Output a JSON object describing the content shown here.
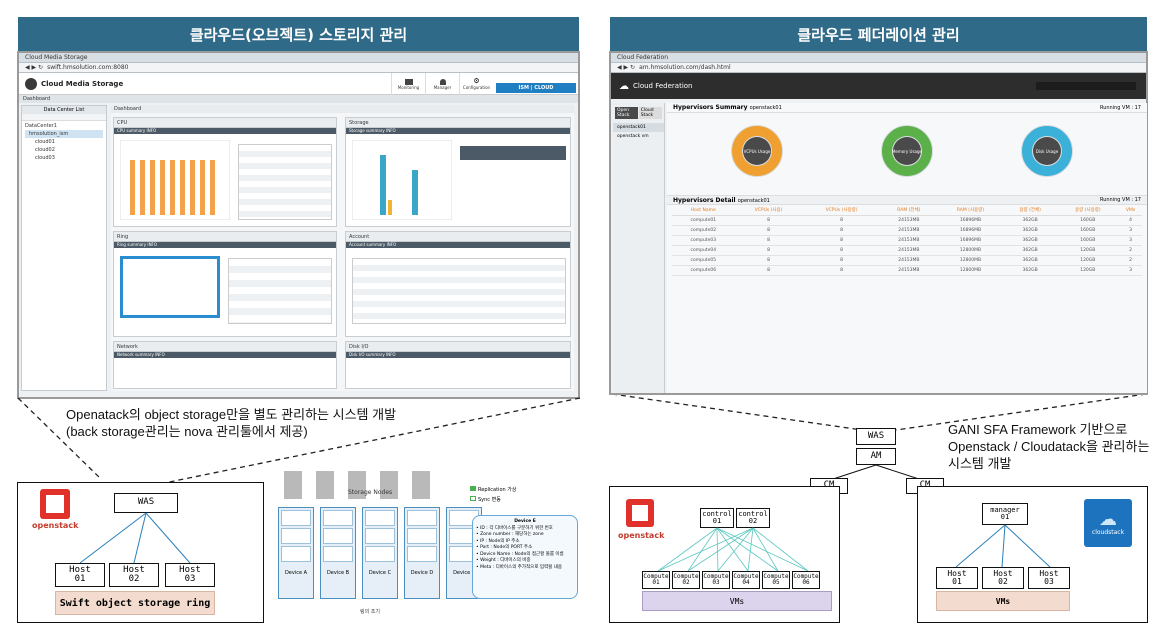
{
  "left": {
    "header": "클라우드(오브젝트) 스토리지 관리",
    "browser": {
      "tab": "Cloud Media Storage",
      "url": "swift.hmsolution.com:8080",
      "app_title": "Cloud Media Storage",
      "nav": [
        "Monitoring",
        "Manager",
        "Configuration"
      ],
      "badge": "ISM | CLOUD",
      "dashboard_label": "Dashboard",
      "tree_header": "Data Center List",
      "tree_items": [
        "DataCenter1",
        "hmsolution_ism",
        "cloud01",
        "cloud02",
        "cloud03"
      ],
      "cards": [
        "CPU",
        "Storage",
        "Ring",
        "Account",
        "Network",
        "Disk I/O"
      ],
      "card_subs": [
        "CPU summary INFO",
        "Storage summary INFO",
        "Ring summary INFO",
        "Account summary INFO",
        "Network summary INFO",
        "Disk I/O summary INFO"
      ]
    },
    "caption_line1": "Openatack의 object storage만을 별도 관리하는 시스템 개발",
    "caption_line2": "(back storage관리는 nova 관리툴에서 제공)",
    "diagram": {
      "logo_text": "openstack",
      "was": "WAS",
      "hosts": [
        "Host\n01",
        "Host\n02",
        "Host\n03"
      ],
      "ring": "Swift object storage ring"
    },
    "storage_fig": {
      "title": "Storage Nodes",
      "devices": [
        "Device A",
        "Device B",
        "Device C",
        "Device D",
        "Device E"
      ],
      "legend": [
        "Replication 가상",
        "Sync 변동"
      ],
      "note_title": "Device E",
      "note_lines": [
        "• ID : 각 디바이스를 구분하기 위한 번호",
        "• Zone number : 해당하는 zone",
        "• IP : Node의 IP 주소",
        "• Port : Node의 PORT 주소",
        "• Device Name : Node의 접근할 볼륨 이름",
        "• Weight : 디바이스의 비중",
        "• Meta : 디바이스의 추가적으로 입력될 내용"
      ],
      "footer": "링의 조기"
    }
  },
  "right": {
    "header": "클라우드 페더레이션 관리",
    "browser": {
      "tab": "Cloud Federation",
      "url": "am.hmsolution.com/dash.html",
      "app_title": "Cloud Federation",
      "tabs": [
        "Open Stack",
        "Cloud Stack"
      ],
      "side_items": [
        "openstack01",
        "openstack vm"
      ],
      "summary_title": "Hypervisors Summary",
      "summary_sub": "openstack01",
      "running": "Running VM : 17",
      "gauges": [
        {
          "label": "VCPUs Usage",
          "color": "#f0a030"
        },
        {
          "label": "Memory Usage",
          "color": "#5bb04a"
        },
        {
          "label": "Disk Usage",
          "color": "#3bb0d8"
        }
      ],
      "detail_title": "Hypervisors Detail",
      "detail_sub": "openstack01",
      "columns": [
        "Host Name",
        "VCPUs (사용)",
        "VCPUs (사용량)",
        "RAM (전체)",
        "RAM (사용량)",
        "용량 (전체)",
        "용량 (사용량)",
        "VMs"
      ],
      "rows": [
        [
          "compute01",
          "8",
          "8",
          "24153MB",
          "16896MB",
          "362GB",
          "160GB",
          "4"
        ],
        [
          "compute02",
          "8",
          "8",
          "24153MB",
          "16896MB",
          "362GB",
          "160GB",
          "3"
        ],
        [
          "compute03",
          "8",
          "8",
          "24153MB",
          "16896MB",
          "362GB",
          "160GB",
          "3"
        ],
        [
          "compute04",
          "8",
          "8",
          "24153MB",
          "12800MB",
          "362GB",
          "120GB",
          "2"
        ],
        [
          "compute05",
          "8",
          "8",
          "24153MB",
          "12800MB",
          "362GB",
          "120GB",
          "2"
        ],
        [
          "compute06",
          "8",
          "8",
          "24153MB",
          "12800MB",
          "362GB",
          "120GB",
          "3"
        ]
      ]
    },
    "caption_line1": "GANI SFA Framework 기반으로",
    "caption_line2": "Openstack / Cloudatack을 관리하는",
    "caption_line3": "시스템 개발",
    "diagram": {
      "was": "WAS",
      "am": "AM",
      "cm_left": "CM",
      "cm_right": "CM",
      "logo_text": "openstack",
      "controls": [
        "control\n01",
        "control\n02"
      ],
      "computes": [
        "Compute\n01",
        "Compute\n02",
        "Compute\n03",
        "Compute\n04",
        "Compute\n05",
        "Compute\n06"
      ],
      "vms_left": "VMs",
      "manager": "manager\n01",
      "hosts": [
        "Host\n01",
        "Host\n02",
        "Host\n03"
      ],
      "vms_right": "VMs",
      "cloudstack_logo": "cloudstack"
    }
  }
}
